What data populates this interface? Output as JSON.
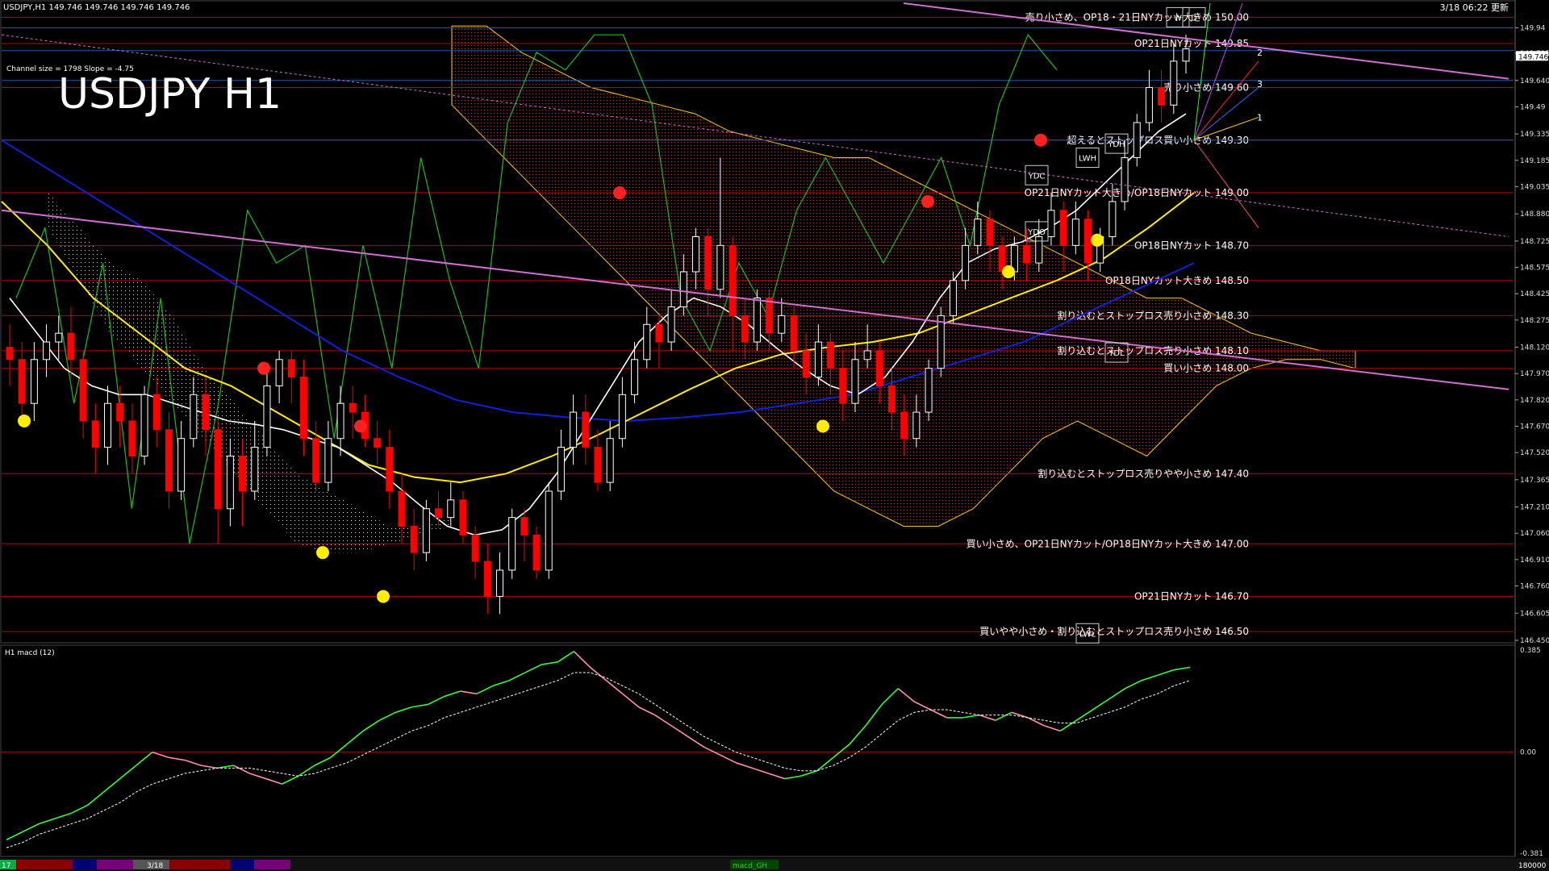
{
  "header": {
    "symbol_info": "USDJPY,H1  149.746 149.746 149.746 149.746",
    "timestamp": "3/18 06:22 更新",
    "channel_info": "Channel size = 1798 Slope = -4.75",
    "big_title": "USDJPY H1"
  },
  "macd_panel": {
    "label": "H1  macd (12)",
    "ticks": [
      "0.385",
      "0.00",
      "-0.381"
    ]
  },
  "bottom_bar": {
    "left_label": "17",
    "date_label": "3/18",
    "center_label": "macd_GH",
    "right_label": "180000"
  },
  "colors": {
    "bull": "#ffffff",
    "bear": "#ff0000",
    "level_line": "#c00000",
    "blue_line": "#1e5aa8",
    "channel": "#d070d0",
    "ma_white": "#ffffff",
    "ma_yellow": "#ffee00",
    "ma_blue": "#1020e0",
    "chikou": "#18c018",
    "cloud": "#b04020",
    "macd_up": "#33ff33",
    "macd_down": "#ff8fb0",
    "macd_signal": "#ffffff"
  },
  "chart_data": {
    "type": "line",
    "title": "USDJPY H1",
    "ylim": [
      146.45,
      150.08
    ],
    "y_ticks": [
      149.94,
      149.795,
      149.64,
      149.49,
      149.335,
      149.185,
      149.035,
      148.88,
      148.725,
      148.575,
      148.425,
      148.275,
      148.12,
      147.97,
      147.82,
      147.67,
      147.52,
      147.365,
      147.21,
      147.06,
      146.91,
      146.76,
      146.605,
      146.45
    ],
    "y_tick_labels": [
      "149.94",
      "149.795",
      "149.640",
      "149.49",
      "149.335",
      "149.185",
      "149.035",
      "148.880",
      "148.725",
      "148.575",
      "148.425",
      "148.275",
      "148.120",
      "147.970",
      "147.820",
      "147.670",
      "147.520",
      "147.365",
      "147.210",
      "147.060",
      "146.910",
      "146.760",
      "146.605",
      "146.450"
    ],
    "current_price": "149.746",
    "levels": [
      {
        "price": 150.0,
        "label": "売り小さめ、OP18・21日NYカット大きめ 150.00"
      },
      {
        "price": 149.85,
        "label": "OP21日NYカット 149.85"
      },
      {
        "price": 149.6,
        "label": "売り小さめ 149.60"
      },
      {
        "price": 149.3,
        "label": "超えるとストップロス買い小さめ 149.30"
      },
      {
        "price": 149.0,
        "label": "OP21日NYカット大きめ/OP18日NYカット 149.00"
      },
      {
        "price": 148.7,
        "label": "OP18日NYカット 148.70"
      },
      {
        "price": 148.5,
        "label": "OP18日NYカット大きめ 148.50"
      },
      {
        "price": 148.3,
        "label": "割り込むとストップロス売り小さめ 148.30"
      },
      {
        "price": 148.1,
        "label": "割り込むとストップロス売り小さめ 148.10"
      },
      {
        "price": 148.0,
        "label": "買い小さめ 148.00"
      },
      {
        "price": 147.4,
        "label": "割り込むとストップロス売りやや小さめ 147.40"
      },
      {
        "price": 147.0,
        "label": "買い小さめ、OP21日NYカット/OP18日NYカット大きめ 147.00"
      },
      {
        "price": 146.7,
        "label": "OP21日NYカット 146.70"
      },
      {
        "price": 146.5,
        "label": "買いやや小さめ・割り込むとストップロス売り小さめ 146.50"
      }
    ],
    "markers": [
      "YDC",
      "YDO",
      "YDH",
      "YDL",
      "LWH",
      "LWL",
      "W",
      "D"
    ],
    "fan_labels": [
      "1",
      "2",
      "3"
    ],
    "candles": [
      [
        148.12,
        148.05,
        148.25,
        147.9
      ],
      [
        148.05,
        147.8,
        148.15,
        147.7
      ],
      [
        147.8,
        148.05,
        148.15,
        147.7
      ],
      [
        148.05,
        148.15,
        148.25,
        147.95
      ],
      [
        148.15,
        148.2,
        148.3,
        148.05
      ],
      [
        148.2,
        148.05,
        148.35,
        147.95
      ],
      [
        148.05,
        147.7,
        148.1,
        147.6
      ],
      [
        147.7,
        147.55,
        147.8,
        147.4
      ],
      [
        147.55,
        147.8,
        147.9,
        147.45
      ],
      [
        147.8,
        147.7,
        147.9,
        147.55
      ],
      [
        147.7,
        147.5,
        147.8,
        147.4
      ],
      [
        147.5,
        147.85,
        147.9,
        147.45
      ],
      [
        147.85,
        147.65,
        147.95,
        147.55
      ],
      [
        147.65,
        147.3,
        147.75,
        147.2
      ],
      [
        147.3,
        147.6,
        147.7,
        147.25
      ],
      [
        147.6,
        147.85,
        147.95,
        147.55
      ],
      [
        147.85,
        147.65,
        147.95,
        147.5
      ],
      [
        147.65,
        147.2,
        147.7,
        147.0
      ],
      [
        147.2,
        147.5,
        147.6,
        147.1
      ],
      [
        147.5,
        147.3,
        147.6,
        147.1
      ],
      [
        147.3,
        147.55,
        147.7,
        147.25
      ],
      [
        147.55,
        147.9,
        148.0,
        147.5
      ],
      [
        147.9,
        148.05,
        148.1,
        147.8
      ],
      [
        148.05,
        147.95,
        148.1,
        147.8
      ],
      [
        147.95,
        147.6,
        148.05,
        147.5
      ],
      [
        147.6,
        147.35,
        147.7,
        147.3
      ],
      [
        147.35,
        147.6,
        147.7,
        147.3
      ],
      [
        147.6,
        147.8,
        147.9,
        147.5
      ],
      [
        147.8,
        147.75,
        147.9,
        147.6
      ],
      [
        147.75,
        147.6,
        147.85,
        147.55
      ],
      [
        147.6,
        147.55,
        147.7,
        147.45
      ],
      [
        147.55,
        147.3,
        147.65,
        147.2
      ],
      [
        147.3,
        147.1,
        147.4,
        147.0
      ],
      [
        147.1,
        146.95,
        147.2,
        146.85
      ],
      [
        146.95,
        147.2,
        147.25,
        146.9
      ],
      [
        147.2,
        147.15,
        147.3,
        147.1
      ],
      [
        147.15,
        147.25,
        147.35,
        147.1
      ],
      [
        147.25,
        147.05,
        147.3,
        147.0
      ],
      [
        147.05,
        146.9,
        147.1,
        146.8
      ],
      [
        146.9,
        146.7,
        147.0,
        146.6
      ],
      [
        146.7,
        146.85,
        146.95,
        146.6
      ],
      [
        146.85,
        147.15,
        147.2,
        146.8
      ],
      [
        147.15,
        147.05,
        147.2,
        146.9
      ],
      [
        147.05,
        146.85,
        147.1,
        146.8
      ],
      [
        146.85,
        147.3,
        147.35,
        146.8
      ],
      [
        147.3,
        147.55,
        147.65,
        147.25
      ],
      [
        147.55,
        147.75,
        147.85,
        147.45
      ],
      [
        147.75,
        147.55,
        147.85,
        147.45
      ],
      [
        147.55,
        147.35,
        147.65,
        147.3
      ],
      [
        147.35,
        147.6,
        147.7,
        147.3
      ],
      [
        147.6,
        147.85,
        147.95,
        147.55
      ],
      [
        147.85,
        148.05,
        148.15,
        147.8
      ],
      [
        148.05,
        148.25,
        148.35,
        148.0
      ],
      [
        148.25,
        148.15,
        148.3,
        148.0
      ],
      [
        148.15,
        148.35,
        148.45,
        148.1
      ],
      [
        148.35,
        148.55,
        148.65,
        148.3
      ],
      [
        148.55,
        148.75,
        148.8,
        148.45
      ],
      [
        148.75,
        148.45,
        148.8,
        148.3
      ],
      [
        148.45,
        148.7,
        149.2,
        148.4
      ],
      [
        148.7,
        148.3,
        148.75,
        148.1
      ],
      [
        148.3,
        148.15,
        148.4,
        148.05
      ],
      [
        148.15,
        148.4,
        148.45,
        148.1
      ],
      [
        148.4,
        148.2,
        148.45,
        148.1
      ],
      [
        148.2,
        148.3,
        148.4,
        148.15
      ],
      [
        148.3,
        148.1,
        148.35,
        148.0
      ],
      [
        148.1,
        147.95,
        148.2,
        147.85
      ],
      [
        147.95,
        148.15,
        148.25,
        147.9
      ],
      [
        148.15,
        148.0,
        148.2,
        147.85
      ],
      [
        148.0,
        147.8,
        148.1,
        147.7
      ],
      [
        147.8,
        148.05,
        148.15,
        147.75
      ],
      [
        148.05,
        148.1,
        148.25,
        148.0
      ],
      [
        148.1,
        147.9,
        148.15,
        147.8
      ],
      [
        147.9,
        147.75,
        148.0,
        147.65
      ],
      [
        147.75,
        147.6,
        147.85,
        147.5
      ],
      [
        147.6,
        147.75,
        147.85,
        147.55
      ],
      [
        147.75,
        148.0,
        148.05,
        147.7
      ],
      [
        148.0,
        148.3,
        148.35,
        147.95
      ],
      [
        148.3,
        148.5,
        148.55,
        148.25
      ],
      [
        148.5,
        148.7,
        148.8,
        148.45
      ],
      [
        148.7,
        148.85,
        148.95,
        148.65
      ],
      [
        148.85,
        148.7,
        148.9,
        148.55
      ],
      [
        148.7,
        148.55,
        148.75,
        148.45
      ],
      [
        148.55,
        148.7,
        148.75,
        148.5
      ],
      [
        148.7,
        148.6,
        148.8,
        148.5
      ],
      [
        148.6,
        148.75,
        148.85,
        148.55
      ],
      [
        148.75,
        148.9,
        149.0,
        148.7
      ],
      [
        148.9,
        148.7,
        148.95,
        148.55
      ],
      [
        148.7,
        148.85,
        148.95,
        148.65
      ],
      [
        148.85,
        148.6,
        148.9,
        148.5
      ],
      [
        148.6,
        148.75,
        148.8,
        148.55
      ],
      [
        148.75,
        148.95,
        149.05,
        148.7
      ],
      [
        148.95,
        149.2,
        149.3,
        148.9
      ],
      [
        149.2,
        149.4,
        149.45,
        149.15
      ],
      [
        149.4,
        149.6,
        149.7,
        149.35
      ],
      [
        149.6,
        149.5,
        149.7,
        149.4
      ],
      [
        149.5,
        149.75,
        149.85,
        149.45
      ],
      [
        149.75,
        149.82,
        149.9,
        149.68
      ]
    ],
    "ma_white": [
      148.4,
      148.2,
      148.0,
      147.9,
      147.85,
      147.85,
      147.8,
      147.75,
      147.7,
      147.68,
      147.65,
      147.6,
      147.55,
      147.45,
      147.35,
      147.22,
      147.1,
      147.05,
      147.08,
      147.2,
      147.4,
      147.65,
      147.9,
      148.15,
      148.3,
      148.4,
      148.35,
      148.25,
      148.12,
      148.0,
      147.9,
      147.85,
      147.95,
      148.15,
      148.4,
      148.6,
      148.68,
      148.72,
      148.8,
      148.9,
      149.05,
      149.2,
      149.35,
      149.45
    ],
    "ma_yellow": [
      148.95,
      148.7,
      148.4,
      148.2,
      148.0,
      147.9,
      147.75,
      147.6,
      147.45,
      147.38,
      147.35,
      147.4,
      147.5,
      147.62,
      147.75,
      147.88,
      148.0,
      148.08,
      148.12,
      148.15,
      148.2,
      148.3,
      148.4,
      148.5,
      148.62,
      148.8,
      149.0
    ],
    "ma_blue": [
      149.3,
      149.1,
      148.9,
      148.7,
      148.5,
      148.3,
      148.1,
      147.95,
      147.82,
      147.75,
      147.72,
      147.7,
      147.72,
      147.75,
      147.8,
      147.85,
      147.95,
      148.05,
      148.15,
      148.3,
      148.45,
      148.6
    ],
    "chikou": [
      148.4,
      148.8,
      147.8,
      148.6,
      147.2,
      148.4,
      147.0,
      147.8,
      148.9,
      148.6,
      148.7,
      147.6,
      148.7,
      148.0,
      149.2,
      148.5,
      148.0,
      149.4,
      149.8,
      149.7,
      149.9,
      149.9,
      149.5,
      148.4,
      148.1,
      148.6,
      148.3,
      148.9,
      149.2,
      148.9,
      148.6,
      148.9,
      149.2,
      148.7,
      149.5,
      149.9,
      149.7
    ],
    "macd": [
      -0.33,
      -0.3,
      -0.27,
      -0.25,
      -0.23,
      -0.2,
      -0.15,
      -0.1,
      -0.05,
      0.0,
      -0.02,
      -0.03,
      -0.05,
      -0.06,
      -0.05,
      -0.08,
      -0.1,
      -0.12,
      -0.09,
      -0.05,
      -0.02,
      0.03,
      0.08,
      0.12,
      0.15,
      0.17,
      0.18,
      0.21,
      0.23,
      0.22,
      0.25,
      0.27,
      0.3,
      0.33,
      0.34,
      0.38,
      0.32,
      0.27,
      0.22,
      0.17,
      0.14,
      0.1,
      0.06,
      0.02,
      -0.01,
      -0.04,
      -0.06,
      -0.08,
      -0.1,
      -0.09,
      -0.07,
      -0.02,
      0.03,
      0.1,
      0.18,
      0.24,
      0.19,
      0.16,
      0.13,
      0.13,
      0.14,
      0.12,
      0.15,
      0.13,
      0.1,
      0.08,
      0.12,
      0.16,
      0.2,
      0.24,
      0.27,
      0.29,
      0.31,
      0.32
    ],
    "macd_signal": [
      -0.36,
      -0.34,
      -0.31,
      -0.29,
      -0.27,
      -0.25,
      -0.22,
      -0.19,
      -0.15,
      -0.12,
      -0.1,
      -0.08,
      -0.07,
      -0.06,
      -0.06,
      -0.06,
      -0.07,
      -0.08,
      -0.09,
      -0.08,
      -0.06,
      -0.04,
      -0.01,
      0.02,
      0.05,
      0.08,
      0.1,
      0.13,
      0.15,
      0.17,
      0.19,
      0.21,
      0.23,
      0.25,
      0.27,
      0.3,
      0.3,
      0.28,
      0.25,
      0.22,
      0.18,
      0.14,
      0.1,
      0.06,
      0.03,
      0.0,
      -0.02,
      -0.04,
      -0.06,
      -0.07,
      -0.07,
      -0.05,
      -0.02,
      0.02,
      0.07,
      0.12,
      0.15,
      0.16,
      0.16,
      0.15,
      0.14,
      0.14,
      0.14,
      0.13,
      0.12,
      0.11,
      0.11,
      0.13,
      0.15,
      0.17,
      0.2,
      0.22,
      0.25,
      0.27
    ]
  }
}
